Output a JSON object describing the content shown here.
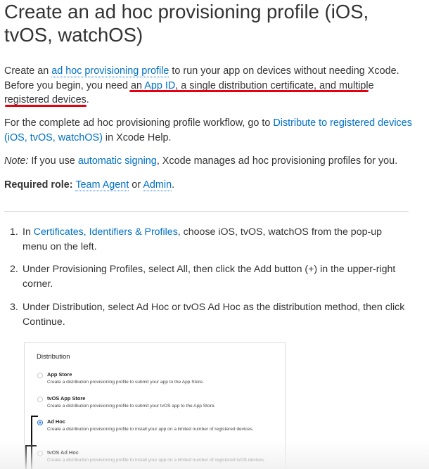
{
  "title": "Create an ad hoc provisioning profile (iOS, tvOS, watchOS)",
  "intro": {
    "text1": "Create an ",
    "link_adhoc": "ad hoc provisioning profile",
    "text2": " to run your app on devices without needing Xcode. Before you begin, you need ",
    "text3": "an ",
    "link_appid": "App ID",
    "text4": ", a single distribution certificate, and multiple registered devices",
    "text5": "."
  },
  "workflow": {
    "text1": "For the complete ad hoc provisioning profile workflow, go to ",
    "link": "Distribute to registered devices (iOS, tvOS, watchOS)",
    "text2": " in Xcode Help."
  },
  "note": {
    "label": "Note:",
    "text1": " If you use ",
    "link": "automatic signing",
    "text2": ", Xcode manages ad hoc provisioning profiles for you."
  },
  "required_role": {
    "label": "Required role:",
    "link_team_agent": "Team Agent",
    "or": " or ",
    "link_admin": "Admin",
    "period": "."
  },
  "steps": [
    {
      "num": "1.",
      "text1": "In ",
      "link": "Certificates, Identifiers & Profiles",
      "text2": ", choose iOS, tvOS, watchOS from the pop-up menu on the left."
    },
    {
      "num": "2.",
      "text": "Under Provisioning Profiles, select All, then click the Add button (+) in the upper-right corner."
    },
    {
      "num": "3.",
      "text": "Under Distribution, select Ad Hoc or tvOS Ad Hoc as the distribution method, then click Continue."
    }
  ],
  "panel": {
    "title": "Distribution",
    "options": [
      {
        "label": "App Store",
        "desc": "Create a distribution provisioning profile to submit your app to the App Store.",
        "selected": false
      },
      {
        "label": "tvOS App Store",
        "desc": "Create a distribution provisioning profile to submit your tvOS app to the App Store.",
        "selected": false
      },
      {
        "label": "Ad Hoc",
        "desc": "Create a distribution provisioning profile to install your app on a limited number of registered devices.",
        "selected": true
      },
      {
        "label": "tvOS Ad Hoc",
        "desc": "Create a distribution provisioning profile to install your app on a limited number of registered tvOS devices.",
        "selected": false
      }
    ]
  },
  "colors": {
    "link": "#0070c9",
    "annotation_underline": "#e60012",
    "radio_selected": "#2f7be0"
  }
}
